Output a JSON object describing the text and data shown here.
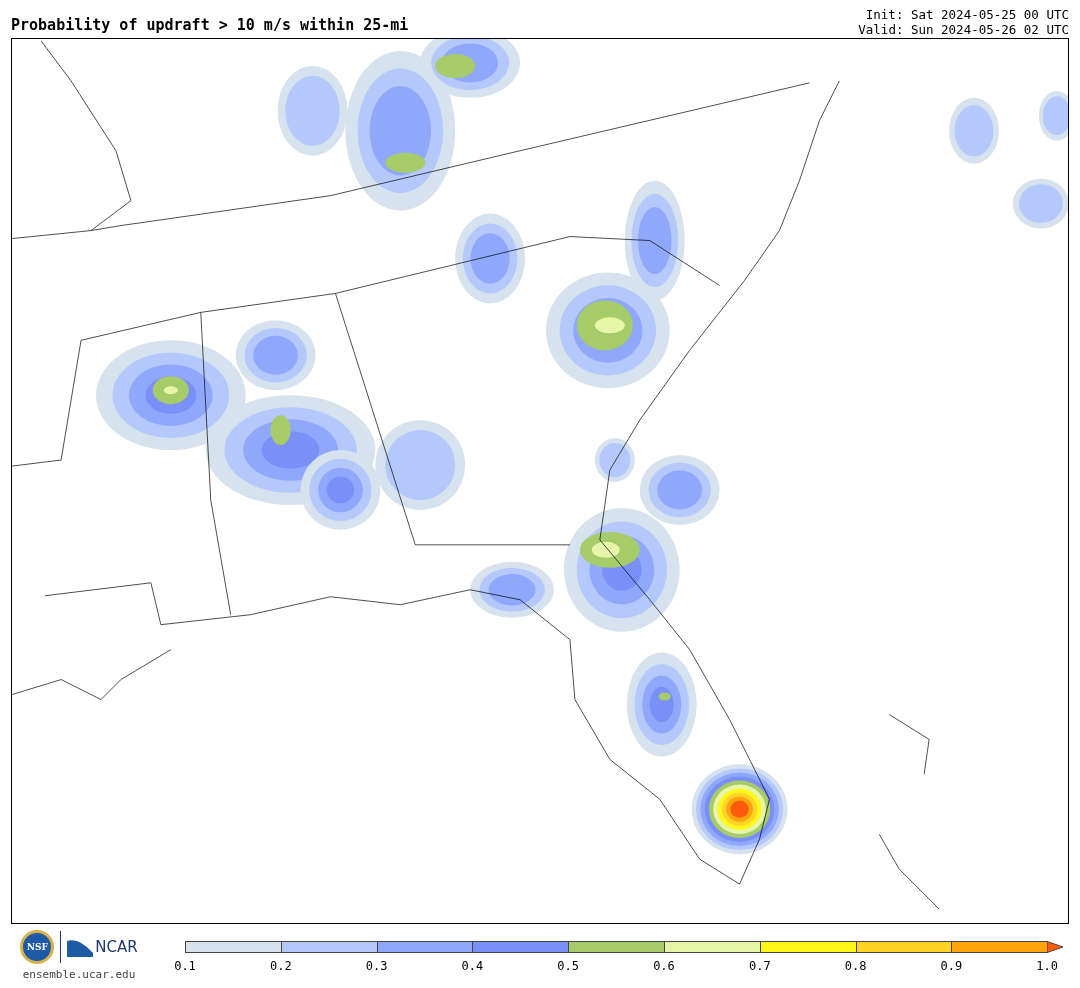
{
  "title": "Probability of updraft > 10 m/s within 25-mi",
  "init": "Init: Sat 2024-05-25 00 UTC",
  "valid": "Valid: Sun 2024-05-26 02 UTC",
  "logos": {
    "nsf": "NSF",
    "ncar": "NCAR"
  },
  "site": "ensemble.ucar.edu",
  "colorbar": {
    "segments": [
      {
        "color": "#d6e2ed"
      },
      {
        "color": "#b4c8fc"
      },
      {
        "color": "#8fa8fb"
      },
      {
        "color": "#7b8ff8"
      },
      {
        "color": "#a6cc6a"
      },
      {
        "color": "#e6f5a8"
      },
      {
        "color": "#fff61c"
      },
      {
        "color": "#ffd327"
      },
      {
        "color": "#ffa40e"
      },
      {
        "color": "#ff5a0b",
        "kind": "arrow"
      }
    ],
    "ticks": [
      "0.1",
      "0.2",
      "0.3",
      "0.4",
      "0.5",
      "0.6",
      "0.7",
      "0.8",
      "0.9",
      "1.0"
    ]
  }
}
